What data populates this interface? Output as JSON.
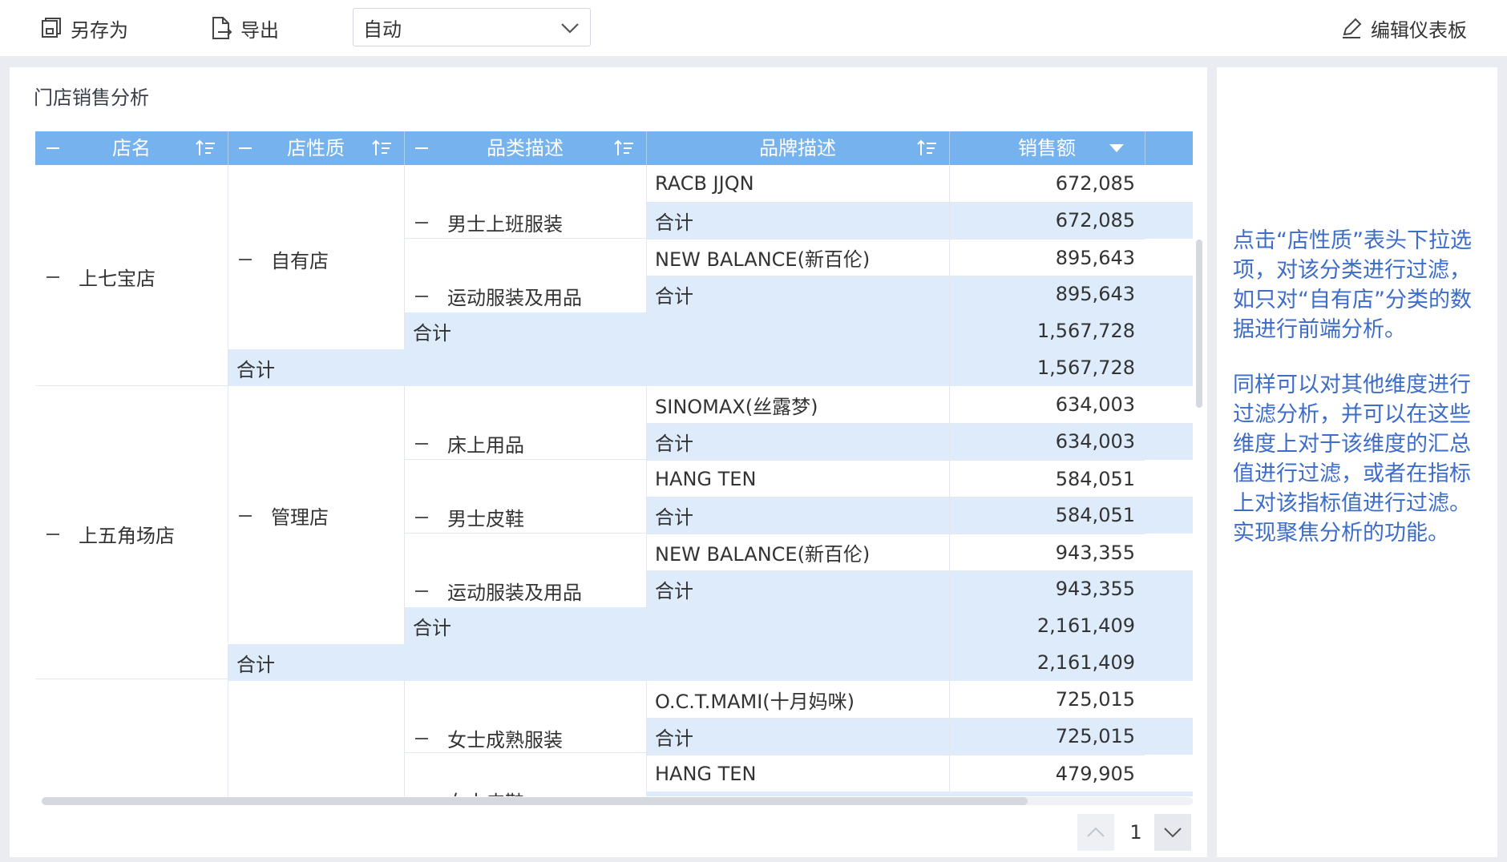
{
  "toolbar": {
    "save_as": "另存为",
    "export": "导出",
    "mode_value": "自动",
    "edit_dashboard": "编辑仪表板"
  },
  "card": {
    "title": "门店销售分析"
  },
  "table": {
    "headers": [
      "店名",
      "店性质",
      "品类描述",
      "品牌描述",
      "销售额"
    ],
    "rows": [
      {
        "brand": "RACB JJQN",
        "value": "672,085"
      },
      {
        "brand": "合计",
        "value": "672,085"
      },
      {
        "brand": "NEW BALANCE(新百伦)",
        "value": "895,643"
      },
      {
        "brand": "合计",
        "value": "895,643"
      },
      {
        "brand": "合计",
        "value": "1,567,728"
      },
      {
        "brand": "合计",
        "value": "1,567,728"
      },
      {
        "brand": "SINOMAX(丝露梦)",
        "value": "634,003"
      },
      {
        "brand": "合计",
        "value": "634,003"
      },
      {
        "brand": "HANG TEN",
        "value": "584,051"
      },
      {
        "brand": "合计",
        "value": "584,051"
      },
      {
        "brand": "NEW BALANCE(新百伦)",
        "value": "943,355"
      },
      {
        "brand": "合计",
        "value": "943,355"
      },
      {
        "brand": "合计",
        "value": "2,161,409"
      },
      {
        "brand": "合计",
        "value": "2,161,409"
      },
      {
        "brand": "O.C.T.MAMI(十月妈咪)",
        "value": "725,015"
      },
      {
        "brand": "合计",
        "value": "725,015"
      },
      {
        "brand": "HANG TEN",
        "value": "479,905"
      }
    ],
    "stores": [
      "上七宝店",
      "上五角场店"
    ],
    "natures": [
      "自有店",
      "管理店"
    ],
    "categories": [
      "男士上班服装",
      "运动服装及用品",
      "床上用品",
      "男士皮鞋",
      "运动服装及用品",
      "女士成熟服装",
      "女士皮鞋"
    ],
    "total_label": "合计"
  },
  "pager": {
    "page": "1"
  },
  "side": {
    "note1": "点击“店性质”表头下拉选项，对该分类进行过滤，如只对“自有店”分类的数据进行前端分析。",
    "note2": "同样可以对其他维度进行过滤分析，并可以在这些维度上对于该维度的汇总值进行过滤，或者在指标上对该指标值进行过滤。实现聚焦分析的功能。"
  },
  "colors": {
    "header_bg": "#76b3ee",
    "total_bg": "#ddebfb",
    "note_text": "#3d6dc9"
  }
}
